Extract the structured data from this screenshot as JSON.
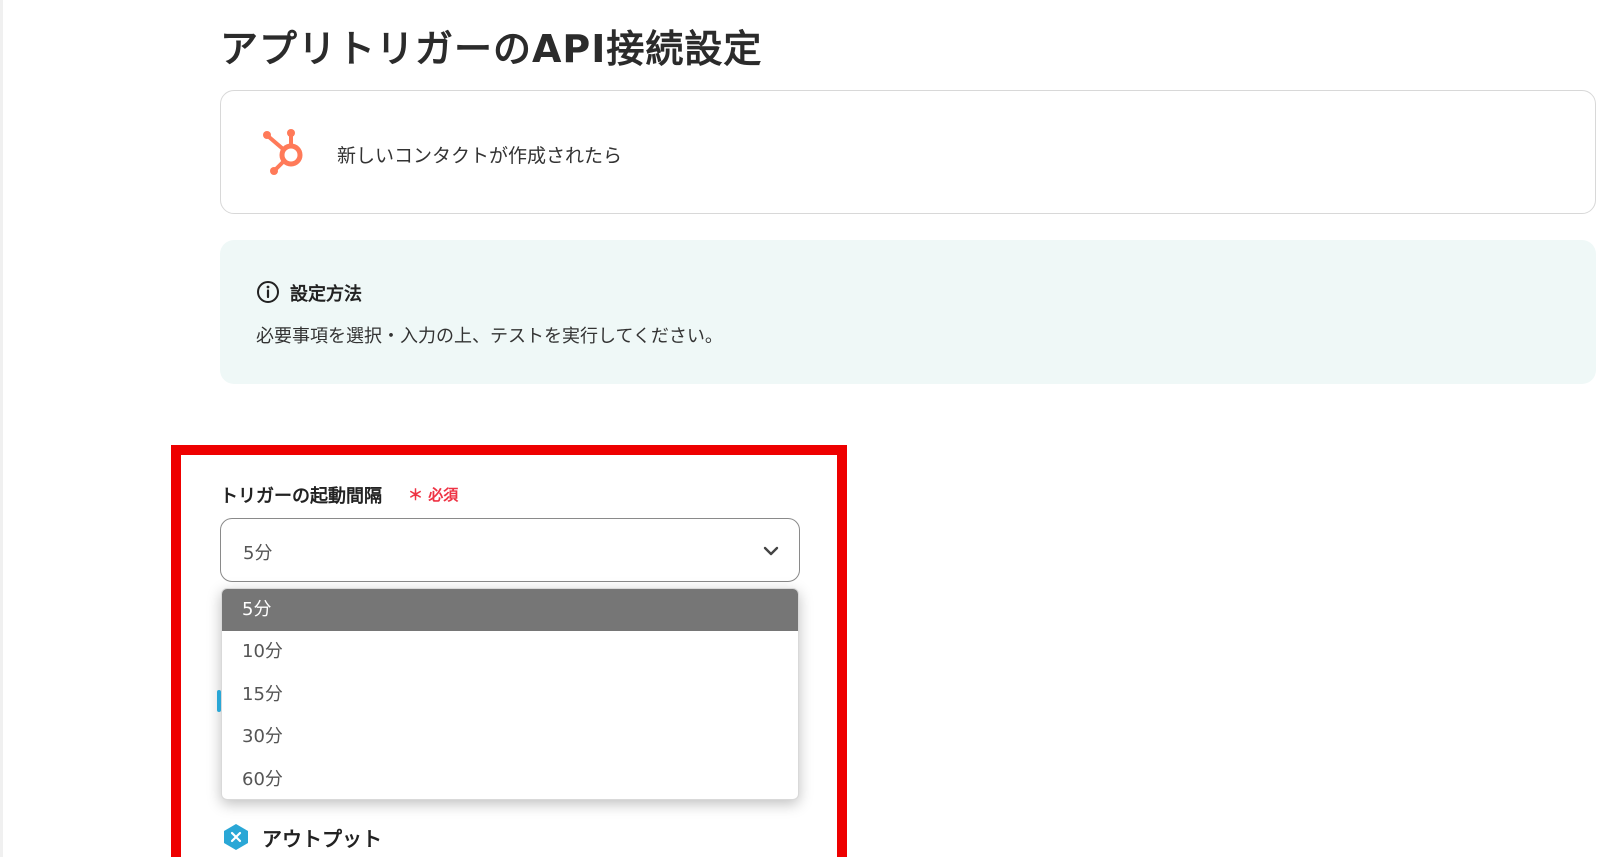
{
  "page": {
    "title": "アプリトリガーのAPI接続設定"
  },
  "trigger": {
    "icon": "hubspot-icon",
    "label": "新しいコンタクトが作成されたら",
    "accent_color": "#ff7a59"
  },
  "info": {
    "icon": "info-circle-icon",
    "title": "設定方法",
    "text": "必要事項を選択・入力の上、テストを実行してください。"
  },
  "interval_field": {
    "label": "トリガーの起動間隔",
    "required_label": "＊ 必須",
    "selected_value": "5分",
    "options": [
      "5分",
      "10分",
      "15分",
      "30分",
      "60分"
    ],
    "highlighted_option": "5分"
  },
  "output": {
    "icon": "output-icon",
    "label": "アウトプット"
  },
  "colors": {
    "highlight_frame": "#ee0000",
    "required": "#ee3344",
    "info_background": "#eff8f7",
    "selected_option_bg": "#767676"
  }
}
